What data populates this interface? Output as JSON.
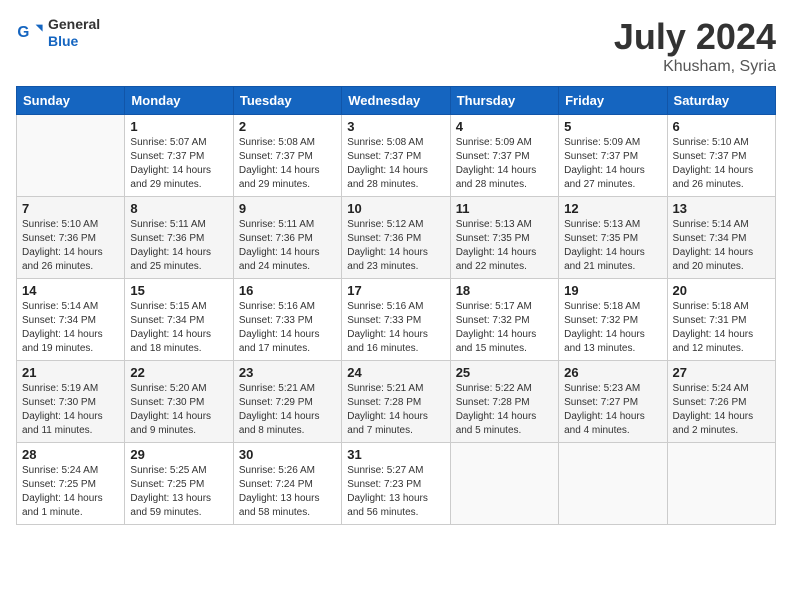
{
  "header": {
    "logo_general": "General",
    "logo_blue": "Blue",
    "title": "July 2024",
    "location": "Khusham, Syria"
  },
  "weekdays": [
    "Sunday",
    "Monday",
    "Tuesday",
    "Wednesday",
    "Thursday",
    "Friday",
    "Saturday"
  ],
  "weeks": [
    [
      {
        "day": "",
        "info": ""
      },
      {
        "day": "1",
        "info": "Sunrise: 5:07 AM\nSunset: 7:37 PM\nDaylight: 14 hours\nand 29 minutes."
      },
      {
        "day": "2",
        "info": "Sunrise: 5:08 AM\nSunset: 7:37 PM\nDaylight: 14 hours\nand 29 minutes."
      },
      {
        "day": "3",
        "info": "Sunrise: 5:08 AM\nSunset: 7:37 PM\nDaylight: 14 hours\nand 28 minutes."
      },
      {
        "day": "4",
        "info": "Sunrise: 5:09 AM\nSunset: 7:37 PM\nDaylight: 14 hours\nand 28 minutes."
      },
      {
        "day": "5",
        "info": "Sunrise: 5:09 AM\nSunset: 7:37 PM\nDaylight: 14 hours\nand 27 minutes."
      },
      {
        "day": "6",
        "info": "Sunrise: 5:10 AM\nSunset: 7:37 PM\nDaylight: 14 hours\nand 26 minutes."
      }
    ],
    [
      {
        "day": "7",
        "info": "Sunrise: 5:10 AM\nSunset: 7:36 PM\nDaylight: 14 hours\nand 26 minutes."
      },
      {
        "day": "8",
        "info": "Sunrise: 5:11 AM\nSunset: 7:36 PM\nDaylight: 14 hours\nand 25 minutes."
      },
      {
        "day": "9",
        "info": "Sunrise: 5:11 AM\nSunset: 7:36 PM\nDaylight: 14 hours\nand 24 minutes."
      },
      {
        "day": "10",
        "info": "Sunrise: 5:12 AM\nSunset: 7:36 PM\nDaylight: 14 hours\nand 23 minutes."
      },
      {
        "day": "11",
        "info": "Sunrise: 5:13 AM\nSunset: 7:35 PM\nDaylight: 14 hours\nand 22 minutes."
      },
      {
        "day": "12",
        "info": "Sunrise: 5:13 AM\nSunset: 7:35 PM\nDaylight: 14 hours\nand 21 minutes."
      },
      {
        "day": "13",
        "info": "Sunrise: 5:14 AM\nSunset: 7:34 PM\nDaylight: 14 hours\nand 20 minutes."
      }
    ],
    [
      {
        "day": "14",
        "info": "Sunrise: 5:14 AM\nSunset: 7:34 PM\nDaylight: 14 hours\nand 19 minutes."
      },
      {
        "day": "15",
        "info": "Sunrise: 5:15 AM\nSunset: 7:34 PM\nDaylight: 14 hours\nand 18 minutes."
      },
      {
        "day": "16",
        "info": "Sunrise: 5:16 AM\nSunset: 7:33 PM\nDaylight: 14 hours\nand 17 minutes."
      },
      {
        "day": "17",
        "info": "Sunrise: 5:16 AM\nSunset: 7:33 PM\nDaylight: 14 hours\nand 16 minutes."
      },
      {
        "day": "18",
        "info": "Sunrise: 5:17 AM\nSunset: 7:32 PM\nDaylight: 14 hours\nand 15 minutes."
      },
      {
        "day": "19",
        "info": "Sunrise: 5:18 AM\nSunset: 7:32 PM\nDaylight: 14 hours\nand 13 minutes."
      },
      {
        "day": "20",
        "info": "Sunrise: 5:18 AM\nSunset: 7:31 PM\nDaylight: 14 hours\nand 12 minutes."
      }
    ],
    [
      {
        "day": "21",
        "info": "Sunrise: 5:19 AM\nSunset: 7:30 PM\nDaylight: 14 hours\nand 11 minutes."
      },
      {
        "day": "22",
        "info": "Sunrise: 5:20 AM\nSunset: 7:30 PM\nDaylight: 14 hours\nand 9 minutes."
      },
      {
        "day": "23",
        "info": "Sunrise: 5:21 AM\nSunset: 7:29 PM\nDaylight: 14 hours\nand 8 minutes."
      },
      {
        "day": "24",
        "info": "Sunrise: 5:21 AM\nSunset: 7:28 PM\nDaylight: 14 hours\nand 7 minutes."
      },
      {
        "day": "25",
        "info": "Sunrise: 5:22 AM\nSunset: 7:28 PM\nDaylight: 14 hours\nand 5 minutes."
      },
      {
        "day": "26",
        "info": "Sunrise: 5:23 AM\nSunset: 7:27 PM\nDaylight: 14 hours\nand 4 minutes."
      },
      {
        "day": "27",
        "info": "Sunrise: 5:24 AM\nSunset: 7:26 PM\nDaylight: 14 hours\nand 2 minutes."
      }
    ],
    [
      {
        "day": "28",
        "info": "Sunrise: 5:24 AM\nSunset: 7:25 PM\nDaylight: 14 hours\nand 1 minute."
      },
      {
        "day": "29",
        "info": "Sunrise: 5:25 AM\nSunset: 7:25 PM\nDaylight: 13 hours\nand 59 minutes."
      },
      {
        "day": "30",
        "info": "Sunrise: 5:26 AM\nSunset: 7:24 PM\nDaylight: 13 hours\nand 58 minutes."
      },
      {
        "day": "31",
        "info": "Sunrise: 5:27 AM\nSunset: 7:23 PM\nDaylight: 13 hours\nand 56 minutes."
      },
      {
        "day": "",
        "info": ""
      },
      {
        "day": "",
        "info": ""
      },
      {
        "day": "",
        "info": ""
      }
    ]
  ]
}
